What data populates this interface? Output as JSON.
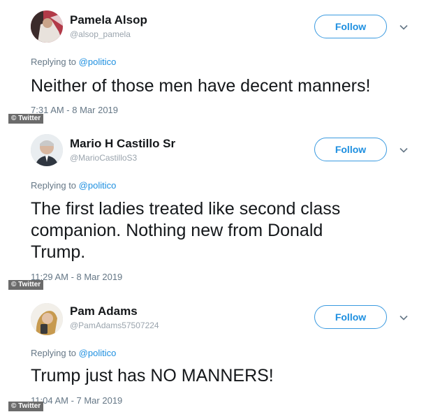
{
  "tweets": [
    {
      "name": "Pamela Alsop",
      "handle": "@alsop_pamela",
      "follow_label": "Follow",
      "replying_prefix": "Replying to",
      "replying_to": "@politico",
      "text": "Neither of those men have decent manners!",
      "timestamp": "7:31 AM - 8 Mar 2019",
      "watermark": "© Twitter"
    },
    {
      "name": "Mario H Castillo Sr",
      "handle": "@MarioCastilloS3",
      "follow_label": "Follow",
      "replying_prefix": "Replying to",
      "replying_to": "@politico",
      "text": "The first ladies treated like second class companion. Nothing new from Donald Trump.",
      "timestamp": "11:29 AM - 8 Mar 2019",
      "watermark": "© Twitter"
    },
    {
      "name": "Pam Adams",
      "handle": "@PamAdams57507224",
      "follow_label": "Follow",
      "replying_prefix": "Replying to",
      "replying_to": "@politico",
      "text": "Trump just has NO MANNERS!",
      "timestamp": "11:04 AM - 7 Mar 2019",
      "watermark": "© Twitter"
    }
  ],
  "icons": {
    "chevron": "chevron-down-icon",
    "avatar": "avatar"
  },
  "colors": {
    "accent": "#1d8fe0",
    "name_text": "#14171a",
    "secondary_text": "#657786",
    "watermark_bg": "#6b6b6b"
  }
}
